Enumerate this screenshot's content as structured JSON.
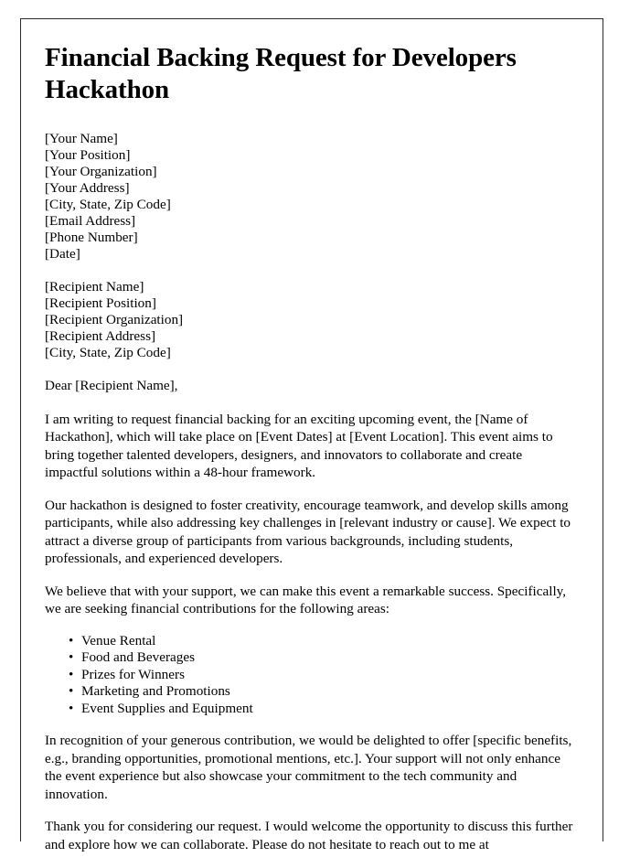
{
  "document": {
    "title": "Financial Backing Request for Developers Hackathon",
    "sender_block": [
      "[Your Name]",
      "[Your Position]",
      "[Your Organization]",
      "[Your Address]",
      "[City, State, Zip Code]",
      "[Email Address]",
      "[Phone Number]",
      "[Date]"
    ],
    "recipient_block": [
      "[Recipient Name]",
      "[Recipient Position]",
      "[Recipient Organization]",
      "[Recipient Address]",
      "[City, State, Zip Code]"
    ],
    "salutation": "Dear [Recipient Name],",
    "paragraph_1": "I am writing to request financial backing for an exciting upcoming event, the [Name of Hackathon], which will take place on [Event Dates] at [Event Location]. This event aims to bring together talented developers, designers, and innovators to collaborate and create impactful solutions within a 48-hour framework.",
    "paragraph_2": "Our hackathon is designed to foster creativity, encourage teamwork, and develop skills among participants, while also addressing key challenges in [relevant industry or cause]. We expect to attract a diverse group of participants from various backgrounds, including students, professionals, and experienced developers.",
    "paragraph_3": "We believe that with your support, we can make this event a remarkable success. Specifically, we are seeking financial contributions for the following areas:",
    "contribution_areas": [
      "Venue Rental",
      "Food and Beverages",
      "Prizes for Winners",
      "Marketing and Promotions",
      "Event Supplies and Equipment"
    ],
    "paragraph_4": "In recognition of your generous contribution, we would be delighted to offer [specific benefits, e.g., branding opportunities, promotional mentions, etc.]. Your support will not only enhance the event experience but also showcase your commitment to the tech community and innovation.",
    "paragraph_5": "Thank you for considering our request. I would welcome the opportunity to discuss this further and explore how we can collaborate. Please do not hesitate to reach out to me at",
    "colors": {
      "page_background": "#ffffff",
      "page_border": "#2b2b2b",
      "text": "#000000"
    }
  }
}
